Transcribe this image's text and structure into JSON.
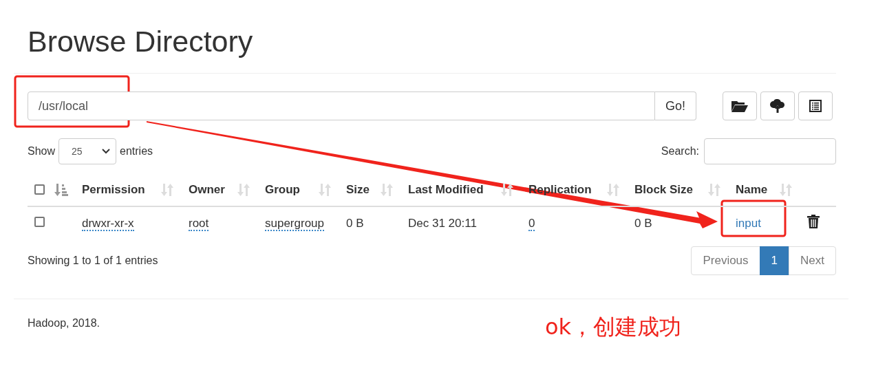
{
  "title": "Browse Directory",
  "path_field": {
    "value": "/usr/local"
  },
  "go_button": "Go!",
  "show_entries": {
    "before": "Show",
    "value": "25",
    "after": "entries"
  },
  "search": {
    "label": "Search:"
  },
  "table": {
    "select_all": {
      "checked": false
    },
    "columns": [
      "Permission",
      "Owner",
      "Group",
      "Size",
      "Last Modified",
      "Replication",
      "Block Size",
      "Name"
    ],
    "rows": [
      {
        "checked": false,
        "permission": "drwxr-xr-x",
        "owner": "root",
        "group": "supergroup",
        "size": "0 B",
        "last_modified": "Dec 31 20:11",
        "replication": "0",
        "block_size": "0 B",
        "name": "input"
      }
    ]
  },
  "info": "Showing 1 to 1 of 1 entries",
  "pagination": [
    {
      "label": "Previous",
      "selected": false
    },
    {
      "label": "1",
      "selected": true
    },
    {
      "label": "Next",
      "selected": false
    }
  ],
  "footer": "Hadoop, 2018.",
  "annotation": "ok，创建成功"
}
